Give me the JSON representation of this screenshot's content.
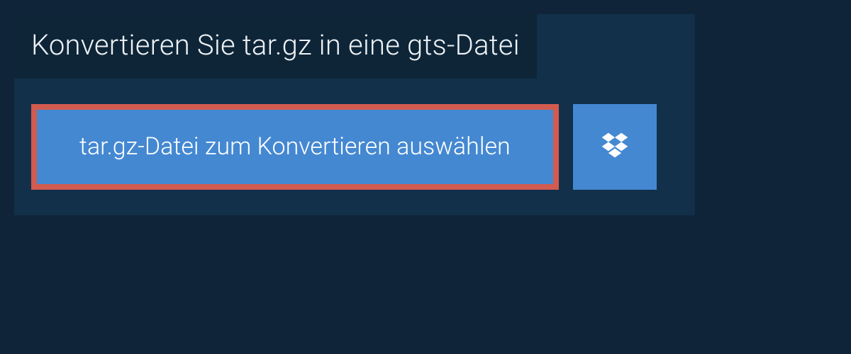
{
  "header": {
    "title": "Konvertieren Sie tar.gz in eine gts-Datei"
  },
  "upload": {
    "select_file_label": "tar.gz-Datei zum Konvertieren auswählen"
  },
  "colors": {
    "page_bg": "#0f2438",
    "panel_bg": "#12304a",
    "header_bg": "#0e2538",
    "button_bg": "#4488d2",
    "highlight_border": "#d25b50",
    "text_light": "#eef2f5",
    "text_white": "#ffffff"
  }
}
